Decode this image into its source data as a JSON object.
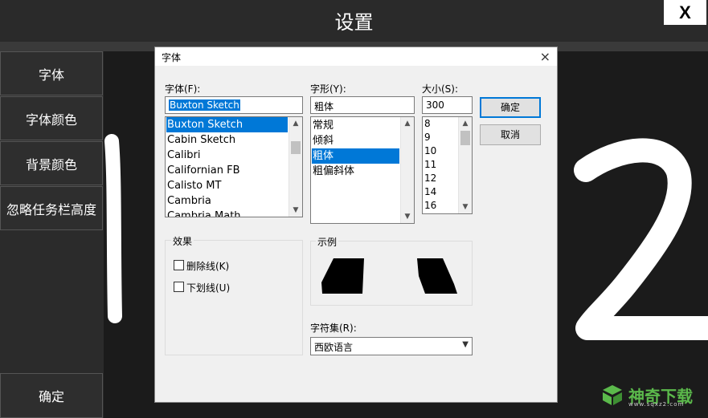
{
  "window": {
    "title": "设置",
    "close_label": "X"
  },
  "sidebar": {
    "items": [
      {
        "label": "字体"
      },
      {
        "label": "字体颜色"
      },
      {
        "label": "背景颜色"
      },
      {
        "label": "忽略任务栏高度"
      }
    ],
    "confirm_label": "确定"
  },
  "dialog": {
    "title": "字体",
    "close_icon": "×",
    "font": {
      "label": "字体(F):",
      "value": "Buxton Sketch",
      "list": [
        "Buxton Sketch",
        "Cabin Sketch",
        "Calibri",
        "Californian FB",
        "Calisto MT",
        "Cambria",
        "Cambria Math"
      ],
      "selected_index": 0
    },
    "style": {
      "label": "字形(Y):",
      "value": "粗体",
      "list": [
        "常规",
        "倾斜",
        "粗体",
        "粗偏斜体"
      ],
      "selected_index": 2
    },
    "size": {
      "label": "大小(S):",
      "value": "300",
      "list": [
        "8",
        "9",
        "10",
        "11",
        "12",
        "14",
        "16"
      ]
    },
    "ok_label": "确定",
    "cancel_label": "取消",
    "effects": {
      "label": "效果",
      "strikeout": {
        "label": "删除线(K)",
        "checked": false
      },
      "underline": {
        "label": "下划线(U)",
        "checked": false
      }
    },
    "sample": {
      "label": "示例"
    },
    "charset": {
      "label": "字符集(R):",
      "value": "西欧语言"
    }
  },
  "watermark": {
    "text": "神奇下载",
    "sub": "www.sqxz2.com"
  },
  "colors": {
    "accent": "#0078d7",
    "dark": "#1b1b1b",
    "brand_green": "#5bb94b"
  }
}
